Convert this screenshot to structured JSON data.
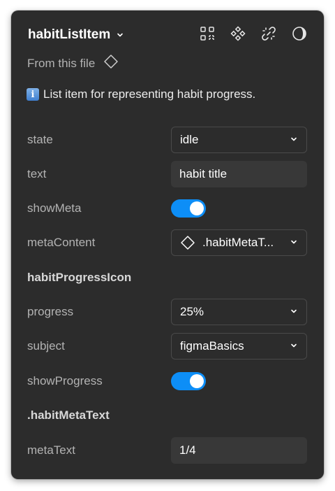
{
  "header": {
    "title": "habitListItem",
    "icons": [
      "select-instances-icon",
      "component-icon",
      "detach-link-icon",
      "appearance-icon"
    ]
  },
  "source": {
    "label": "From this file",
    "icon": "diamond-icon"
  },
  "description": {
    "icon": "info-icon",
    "icon_glyph": "i",
    "text": "List item for representing habit progress."
  },
  "properties": {
    "state": {
      "label": "state",
      "value": "idle"
    },
    "text": {
      "label": "text",
      "value": "habit title"
    },
    "showMeta": {
      "label": "showMeta",
      "on": true
    },
    "metaContent": {
      "label": "metaContent",
      "value": ".habitMetaT..."
    },
    "habitProgressIcon": {
      "label": "habitProgressIcon"
    },
    "progress": {
      "label": "progress",
      "value": "25%"
    },
    "subject": {
      "label": "subject",
      "value": "figmaBasics"
    },
    "showProgress": {
      "label": "showProgress",
      "on": true
    },
    "habitMetaText": {
      "label": ".habitMetaText"
    },
    "metaText": {
      "label": "metaText",
      "value": "1/4"
    }
  },
  "colors": {
    "panel": "#2c2c2c",
    "accent": "#0d8ef7",
    "label": "#b3b3b3"
  }
}
